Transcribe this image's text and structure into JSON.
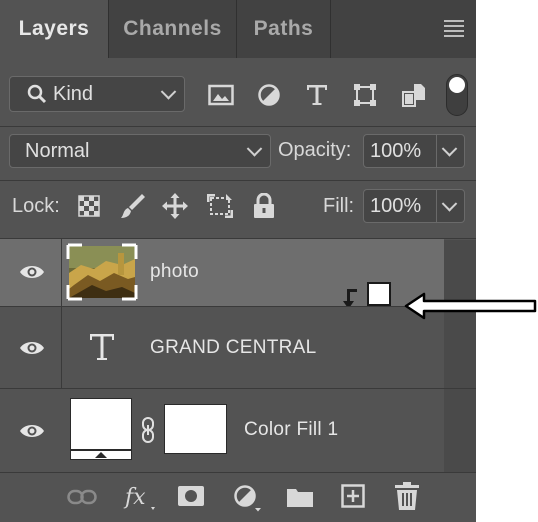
{
  "tabs": [
    {
      "label": "Layers",
      "active": true
    },
    {
      "label": "Channels",
      "active": false
    },
    {
      "label": "Paths",
      "active": false
    }
  ],
  "filter": {
    "kind_label": "Kind",
    "filter_icons": [
      "image-filter-icon",
      "adjustment-filter-icon",
      "type-filter-icon",
      "shape-filter-icon",
      "smart-object-filter-icon"
    ]
  },
  "blend": {
    "mode": "Normal",
    "opacity_label": "Opacity:",
    "opacity_value": "100%"
  },
  "lock": {
    "label": "Lock:",
    "fill_label": "Fill:",
    "fill_value": "100%"
  },
  "layers": [
    {
      "name": "photo",
      "type": "image",
      "selected": true,
      "visible": true
    },
    {
      "name": "GRAND CENTRAL",
      "type": "text",
      "selected": false,
      "visible": true
    },
    {
      "name": "Color Fill 1",
      "type": "fill",
      "selected": false,
      "visible": true
    }
  ],
  "bottom_icons": [
    "link-layers-icon",
    "fx-icon",
    "add-mask-icon",
    "new-adjustment-icon",
    "new-group-icon",
    "new-layer-icon",
    "delete-layer-icon"
  ],
  "colors": {
    "panel": "#535353",
    "tabbar": "#424242",
    "selected_layer": "#6e6e6e",
    "text": "#e6e6e6"
  }
}
